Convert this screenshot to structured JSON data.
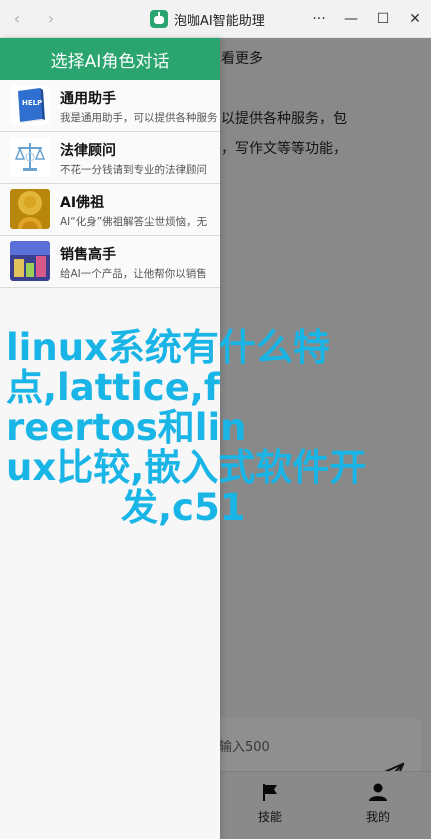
{
  "window": {
    "title": "泡咖AI智能助理",
    "back_icon": "‹",
    "forward_icon": "›",
    "more_icon": "···",
    "minimize_icon": "—",
    "maximize_icon": "☐",
    "close_icon": "✕"
  },
  "main": {
    "line1": "看更多",
    "line2": "以提供各种服务，包",
    "line3": "，写作文等等功能，",
    "input_placeholder": "输入500",
    "tabs": [
      {
        "label": "技能",
        "icon": "flag-icon"
      },
      {
        "label": "我的",
        "icon": "user-icon"
      }
    ]
  },
  "drawer": {
    "header": "选择AI角色对话",
    "roles": [
      {
        "title": "通用助手",
        "desc": "我是通用助手，可以提供各种服务",
        "avatar": "help-book-icon",
        "avatar_label": "HELP"
      },
      {
        "title": "法律顾问",
        "desc": "不花一分钱请到专业的法律顾问",
        "avatar": "law-scale-icon"
      },
      {
        "title": "AI佛祖",
        "desc": "AI“化身”佛祖解答尘世烦恼，无",
        "avatar": "buddha-image"
      },
      {
        "title": "销售高手",
        "desc": "给AI一个产品，让他帮你以销售",
        "avatar": "sales-image"
      }
    ]
  },
  "watermark": {
    "lines": [
      "linux系统有什么特",
      "点,lattice,f",
      "reertos和lin",
      "ux比较,嵌入式软件开",
      "发,c51"
    ]
  },
  "colors": {
    "accent": "#2aa56f",
    "watermark": "#18b5e6"
  }
}
